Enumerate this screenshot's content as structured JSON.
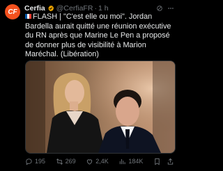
{
  "post": {
    "author_name": "Cerfia",
    "handle": "@CerfiaFR",
    "separator": "·",
    "time": "1 h",
    "avatar_text": "CF",
    "text_flag": "FR",
    "text_body": "FLASH | \"C'est elle ou moi\". Jordan Bardella aurait quitté une réunion exécutive du RN après que Marine Le Pen a proposé de donner plus de visibilité à Marion Maréchal. (Libération)",
    "media_icon": "photo"
  },
  "actions": {
    "replies": "195",
    "reposts": "269",
    "likes": "2,4K",
    "views": "184K"
  },
  "colors": {
    "background": "#000000",
    "text": "#e7e9ea",
    "muted": "#71767b",
    "verified": "#e8a100",
    "avatar": "#f4511e"
  },
  "icons": [
    "verified-icon",
    "grok-icon",
    "more-icon",
    "reply-icon",
    "repost-icon",
    "like-icon",
    "views-icon",
    "bookmark-icon",
    "share-icon"
  ]
}
